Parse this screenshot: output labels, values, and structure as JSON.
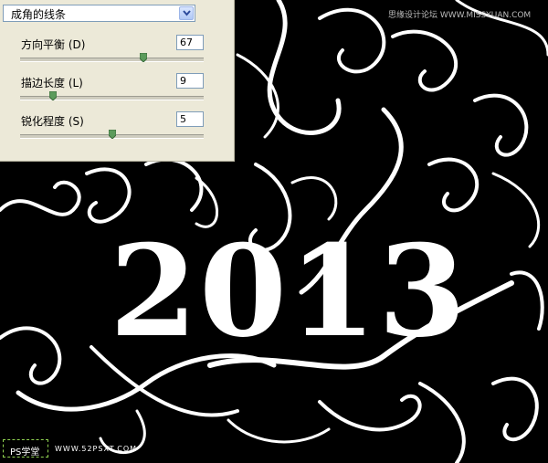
{
  "filter": {
    "name": "成角的线条",
    "controls": [
      {
        "label": "方向平衡 (D)",
        "value": "67",
        "fraction": 0.67
      },
      {
        "label": "描边长度 (L)",
        "value": "9",
        "fraction": 0.18
      },
      {
        "label": "锐化程度 (S)",
        "value": "5",
        "fraction": 0.5
      }
    ]
  },
  "canvas": {
    "year_text": "2013"
  },
  "watermark": {
    "left_logo": "PS学堂",
    "left_site": "WWW.52PSXT.COM",
    "right": "思缘设计论坛 WWW.MISSYUAN.COM"
  },
  "colors": {
    "panel_bg": "#ece9d8",
    "canvas_bg": "#000000",
    "art": "#ffffff"
  }
}
